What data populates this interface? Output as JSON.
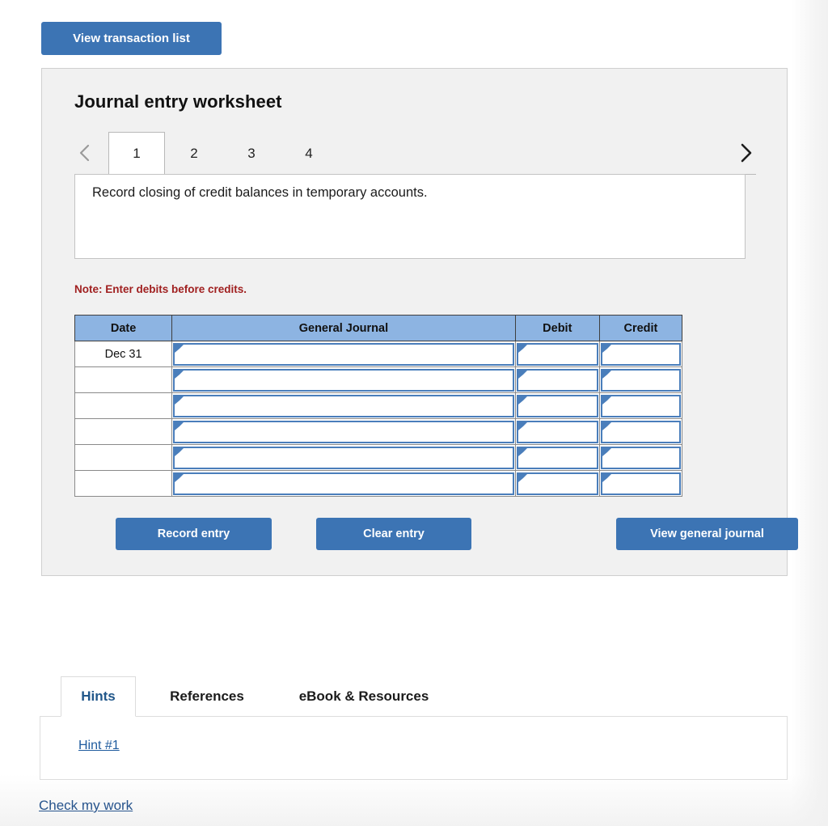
{
  "top_actions": {
    "view_transaction_list_label": "View transaction list"
  },
  "worksheet": {
    "title": "Journal entry worksheet",
    "nav": {
      "prev_icon": "chevron-left-icon",
      "next_icon": "chevron-right-icon"
    },
    "tabs": [
      {
        "label": "1",
        "active": true
      },
      {
        "label": "2",
        "active": false
      },
      {
        "label": "3",
        "active": false
      },
      {
        "label": "4",
        "active": false
      }
    ],
    "description": "Record closing of credit balances in temporary accounts.",
    "note": "Note: Enter debits before credits.",
    "table": {
      "columns": [
        "Date",
        "General Journal",
        "Debit",
        "Credit"
      ],
      "rows": [
        {
          "date": "Dec 31",
          "general_journal": "",
          "debit": "",
          "credit": ""
        },
        {
          "date": "",
          "general_journal": "",
          "debit": "",
          "credit": ""
        },
        {
          "date": "",
          "general_journal": "",
          "debit": "",
          "credit": ""
        },
        {
          "date": "",
          "general_journal": "",
          "debit": "",
          "credit": ""
        },
        {
          "date": "",
          "general_journal": "",
          "debit": "",
          "credit": ""
        },
        {
          "date": "",
          "general_journal": "",
          "debit": "",
          "credit": ""
        }
      ]
    },
    "actions": {
      "record_entry_label": "Record entry",
      "clear_entry_label": "Clear entry",
      "view_general_journal_label": "View general journal"
    }
  },
  "bottom": {
    "tabs": [
      {
        "label": "Hints",
        "active": true
      },
      {
        "label": "References",
        "active": false
      },
      {
        "label": "eBook & Resources",
        "active": false
      }
    ],
    "hint_link": "Hint #1",
    "check_my_work": "Check my work"
  },
  "colors": {
    "button_blue": "#3c74b4",
    "table_header_blue": "#8db4e2",
    "input_border_blue": "#4a7ebb",
    "note_red": "#a02020",
    "link_blue": "#27548d",
    "panel_gray": "#f1f1f1"
  }
}
